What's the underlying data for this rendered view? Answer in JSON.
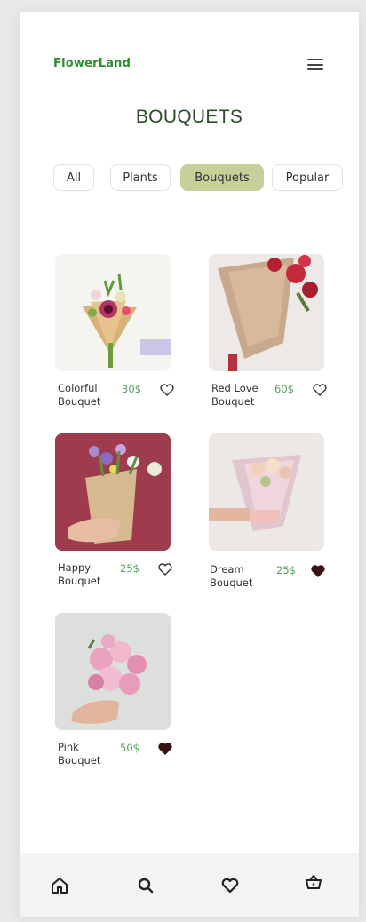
{
  "header": {
    "brand": "FlowerLand"
  },
  "page_title": "BOUQUETS",
  "filters": [
    "All",
    "Plants",
    "Bouquets",
    "Popular"
  ],
  "products": [
    {
      "name": "Colorful Bouquet",
      "price": "30$",
      "favorite": false
    },
    {
      "name": "Red Love Bouquet",
      "price": "60$",
      "favorite": false
    },
    {
      "name": "Happy Bouquet",
      "price": "25$",
      "favorite": false
    },
    {
      "name": "Dream Bouquet",
      "price": "25$",
      "favorite": true
    },
    {
      "name": "Pink Bouquet",
      "price": "50$",
      "favorite": true
    }
  ],
  "bottom_nav": [
    "home-icon",
    "search-icon",
    "heart-icon",
    "basket-icon"
  ],
  "colors": {
    "brand": "#2e8f2f",
    "active_filter": "#c6d09a",
    "price": "#58a35a",
    "heart_filled": "#3a1212"
  }
}
